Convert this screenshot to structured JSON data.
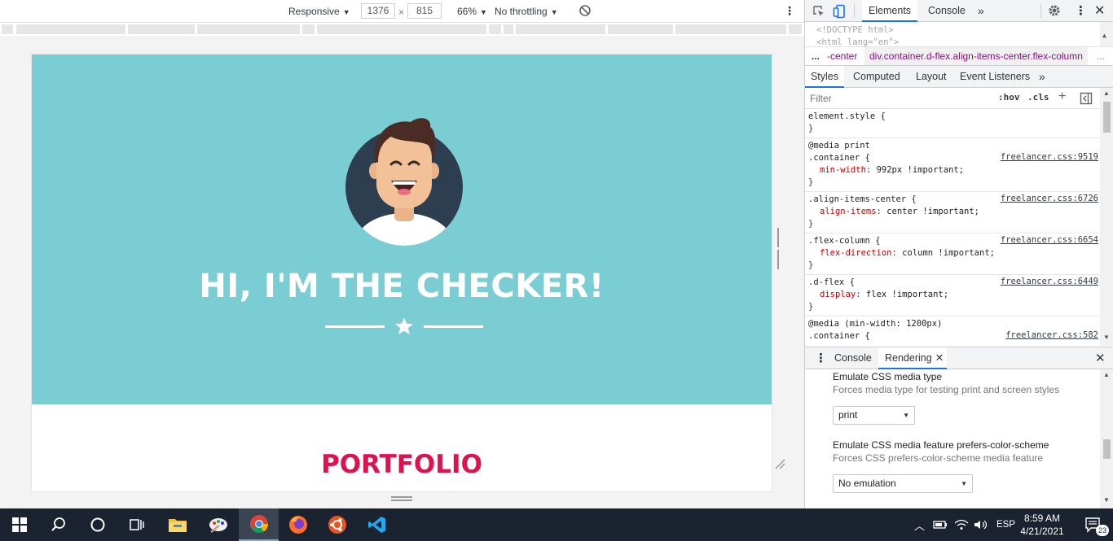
{
  "device_toolbar": {
    "device_label": "Responsive",
    "width_value": "1376",
    "times": "×",
    "height_value": "815",
    "zoom_label": "66%",
    "throttling_label": "No throttling"
  },
  "page": {
    "masthead_heading": "HI, I'M THE CHECKER!",
    "portfolio_heading": "PORTFOLIO",
    "masthead_bg": "#79cdd3",
    "portfolio_color": "#dd1351"
  },
  "devtools": {
    "tabs": {
      "elements": "Elements",
      "console": "Console"
    },
    "tree_lines": [
      "<!DOCTYPE html>",
      "<html lang=\"en\">"
    ],
    "breadcrumb": {
      "ellipsis": "...",
      "prev": "-center",
      "current": "div.container.d-flex.align-items-center.flex-column",
      "more": "..."
    },
    "styles_tabs": [
      "Styles",
      "Computed",
      "Layout",
      "Event Listeners"
    ],
    "filter_placeholder": "Filter",
    "hov": ":hov",
    "cls": ".cls",
    "rules": [
      {
        "header": "element.style {",
        "source": "",
        "props": []
      },
      {
        "header": "@media print",
        "selector": ".container {",
        "source": "freelancer.css:9519",
        "props": [
          {
            "name": "min-width",
            "value": "992px !important;"
          }
        ]
      },
      {
        "header": "",
        "selector": ".align-items-center {",
        "source": "freelancer.css:6726",
        "props": [
          {
            "name": "align-items",
            "value": "center !important;"
          }
        ]
      },
      {
        "header": "",
        "selector": ".flex-column {",
        "source": "freelancer.css:6654",
        "props": [
          {
            "name": "flex-direction",
            "value": "column !important;"
          }
        ]
      },
      {
        "header": "",
        "selector": ".d-flex {",
        "source": "freelancer.css:6449",
        "props": [
          {
            "name": "display",
            "value": "flex !important;"
          }
        ]
      },
      {
        "header": "@media (min-width: 1200px)",
        "selector": ".container {",
        "source": "freelancer.css:582",
        "props": []
      }
    ],
    "drawer": {
      "console": "Console",
      "rendering": "Rendering"
    },
    "rendering": {
      "media_type_title": "Emulate CSS media type",
      "media_type_desc": "Forces media type for testing print and screen styles",
      "media_type_value": "print",
      "color_scheme_title": "Emulate CSS media feature prefers-color-scheme",
      "color_scheme_desc": "Forces CSS prefers-color-scheme media feature",
      "color_scheme_value": "No emulation"
    }
  },
  "taskbar": {
    "language": "ESP",
    "time": "8:59 AM",
    "date": "4/21/2021",
    "notification_count": "23",
    "apps": [
      "start-icon",
      "search-icon",
      "cortana-icon",
      "task-view-icon",
      "file-explorer-icon",
      "paint-icon",
      "chrome-icon",
      "firefox-icon",
      "ubuntu-icon",
      "vscode-icon"
    ]
  }
}
